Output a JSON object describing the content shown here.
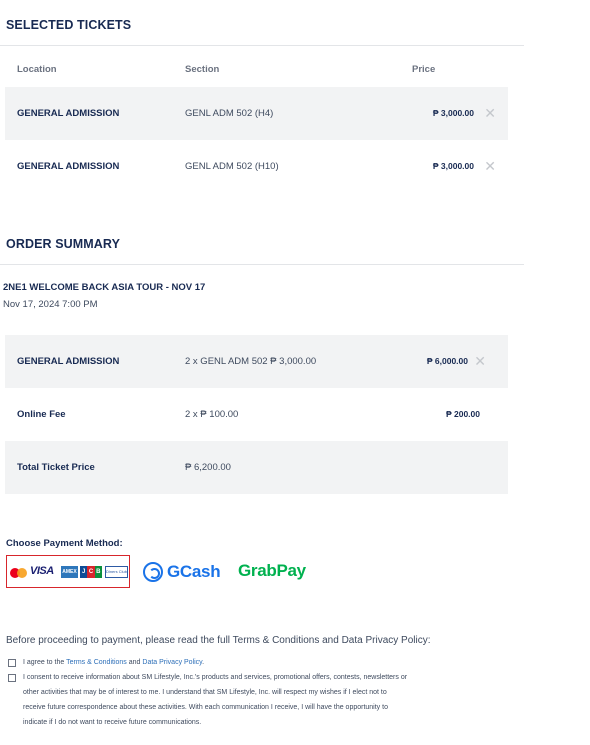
{
  "selected_tickets": {
    "title": "SELECTED TICKETS",
    "headers": {
      "location": "Location",
      "section": "Section",
      "price": "Price"
    },
    "rows": [
      {
        "location": "GENERAL ADMISSION",
        "section": "GENL ADM 502 (H4)",
        "price": "₱ 3,000.00",
        "remove": "✕"
      },
      {
        "location": "GENERAL ADMISSION",
        "section": "GENL ADM 502 (H10)",
        "price": "₱ 3,000.00",
        "remove": "✕"
      }
    ]
  },
  "order_summary": {
    "title": "ORDER SUMMARY",
    "event_title": "2NE1 WELCOME BACK ASIA TOUR - NOV 17",
    "event_date": "Nov 17, 2024 7:00 PM",
    "rows": [
      {
        "label": "GENERAL ADMISSION",
        "detail": "2 x GENL ADM 502 ₱ 3,000.00",
        "amount": "₱ 6,000.00",
        "remove": "✕"
      },
      {
        "label": "Online Fee",
        "detail": "2 x ₱ 100.00",
        "amount": "₱ 200.00"
      },
      {
        "label": "Total Ticket Price",
        "detail": "₱ 6,200.00"
      }
    ]
  },
  "payment": {
    "label": "Choose Payment Method:",
    "card_brands": {
      "visa": "VISA",
      "amex": "AMEX",
      "jcb": [
        "J",
        "C",
        "B"
      ],
      "diners": "Diners Club"
    },
    "gcash": "GCash",
    "grabpay": "GrabPay"
  },
  "terms": {
    "intro": "Before proceeding to payment, please read the full Terms & Conditions and Data Privacy Policy:",
    "agree_prefix": "I agree to the",
    "terms_link": "Terms & Conditions",
    "and": "and",
    "privacy_link": "Data Privacy Policy",
    "period": ".",
    "consent": [
      "I consent to receive information about SM Lifestyle, Inc.'s products and services, promotional offers, contests, newsletters or",
      "other activities that may be of interest to me. I understand that SM Lifestyle, Inc. will respect my wishes if I elect not to",
      "receive future correspondence about these activities. With each communication I receive, I will have the opportunity to",
      "indicate if I do not want to receive future communications."
    ]
  },
  "colors": {
    "heading": "#182a52",
    "row_bg": "#f2f3f4",
    "card_border": "#d7262c",
    "gcash_blue": "#1a73e8",
    "grabpay_green": "#00b14f",
    "link": "#2d6fb8"
  }
}
